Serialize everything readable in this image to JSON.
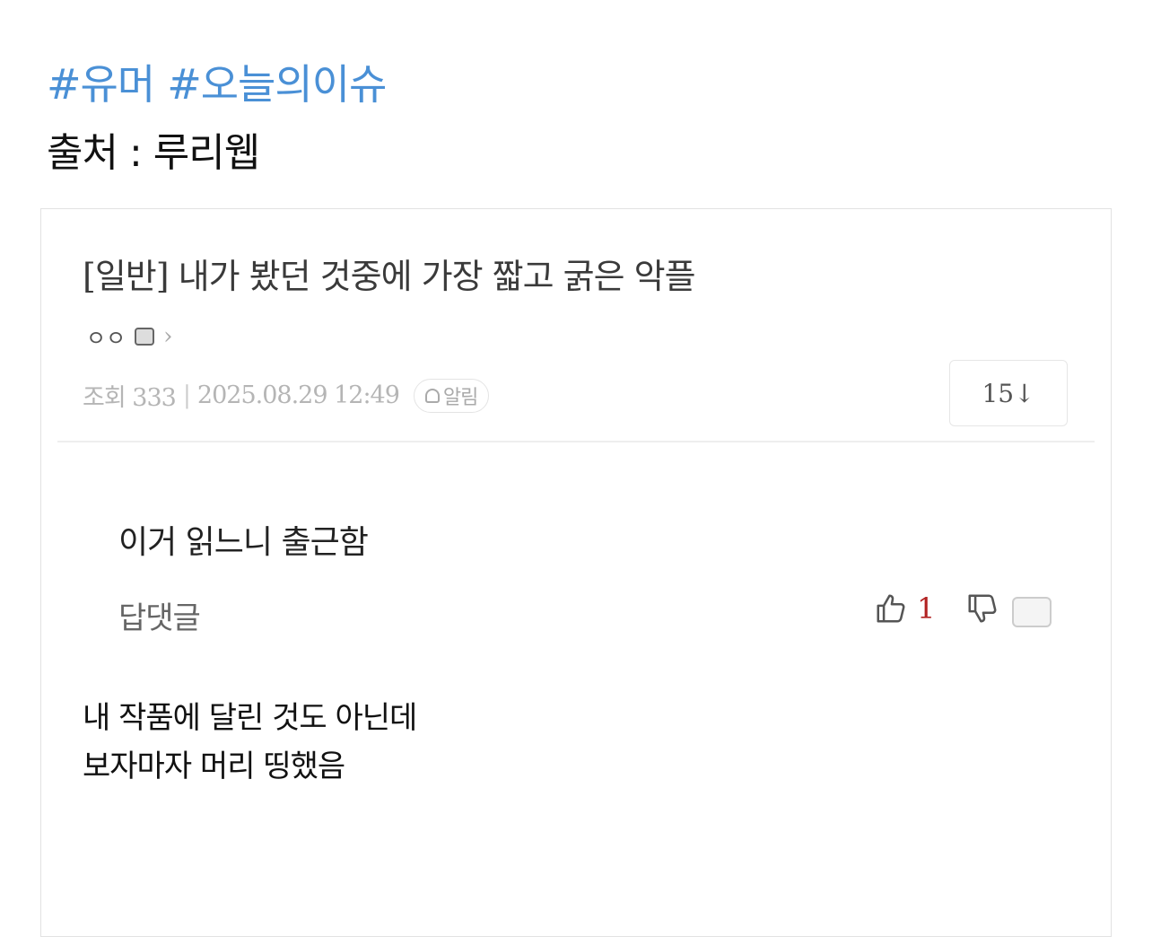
{
  "tags": [
    "#유머",
    "#오늘의이슈"
  ],
  "source": "출처 : 루리웹",
  "post": {
    "title": "[일반] 내가 봤던 것중에 가장 짧고 굵은 악플",
    "author": "ㅇㅇ",
    "views": "조회 333",
    "separator": "|",
    "datetime": "2025.08.29 12:49",
    "alarm_label": "알림",
    "comment_count": "15↓"
  },
  "comment": {
    "text": "이거 읽느니 출근함",
    "reply_label": "답댓글",
    "likes": "1"
  },
  "caption": {
    "line1": "내 작품에 달린 것도 아닌데",
    "line2": "보자마자 머리 띵했음"
  },
  "colors": {
    "tag": "#4a90d6",
    "like": "#b22222"
  },
  "icons": [
    "user-level-icon",
    "chevron-right-icon",
    "bell-icon",
    "thumbs-up-icon",
    "thumbs-down-icon",
    "comment-bubble-icon"
  ]
}
